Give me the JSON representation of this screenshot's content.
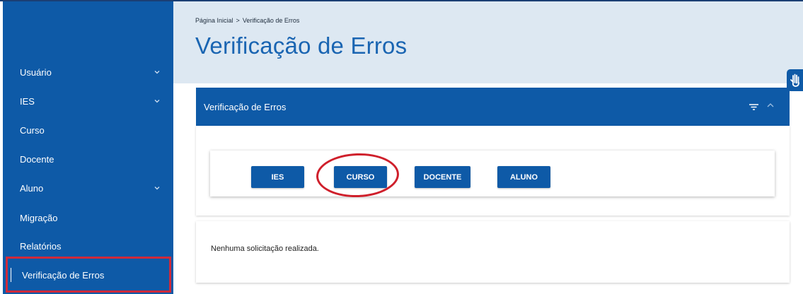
{
  "sidebar": {
    "items": [
      {
        "label": "Usuário",
        "has_chevron": true
      },
      {
        "label": "IES",
        "has_chevron": true
      },
      {
        "label": "Curso",
        "has_chevron": false
      },
      {
        "label": "Docente",
        "has_chevron": false
      },
      {
        "label": "Aluno",
        "has_chevron": true
      },
      {
        "label": "Migração",
        "has_chevron": false
      },
      {
        "label": "Relatórios",
        "has_chevron": false
      },
      {
        "label": "Verificação de Erros",
        "has_chevron": false,
        "active": true
      }
    ]
  },
  "breadcrumb": {
    "home": "Página Inicial",
    "separator": ">",
    "current": "Verificação de Erros"
  },
  "page_title": "Verificação de Erros",
  "panel": {
    "title": "Verificação de Erros",
    "buttons": [
      "IES",
      "CURSO",
      "DOCENTE",
      "ALUNO"
    ],
    "highlighted_button": "CURSO"
  },
  "results": {
    "message": "Nenhuma solicitação realizada."
  },
  "colors": {
    "primary": "#0e5aa7",
    "header_bg": "#dde8f2",
    "title": "#1a65b2",
    "annotation_red": "#cf1f2b"
  },
  "icons": [
    "chevron-down-icon",
    "filter-icon",
    "chevron-up-icon",
    "sign-language-icon"
  ]
}
